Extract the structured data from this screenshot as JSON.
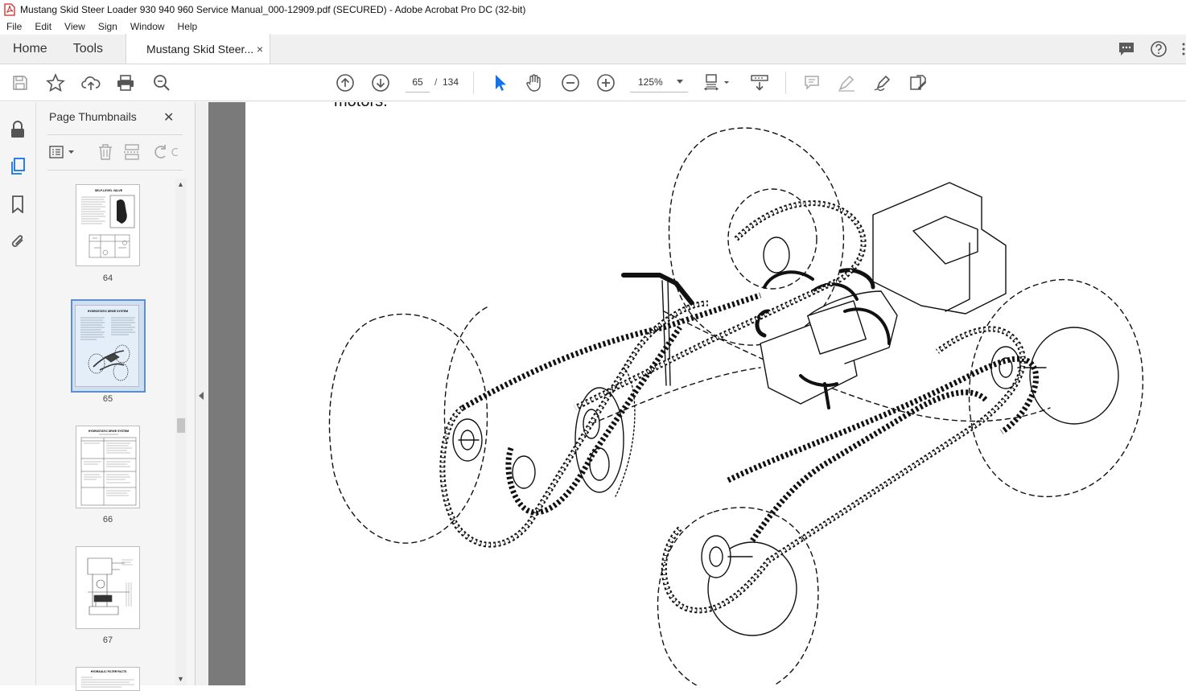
{
  "window": {
    "title": "Mustang Skid Steer Loader 930 940 960 Service Manual_000-12909.pdf (SECURED) - Adobe Acrobat Pro DC (32-bit)"
  },
  "menu": [
    "File",
    "Edit",
    "View",
    "Sign",
    "Window",
    "Help"
  ],
  "tabs": {
    "home": "Home",
    "tools": "Tools",
    "document": "Mustang Skid Steer...",
    "close": "×"
  },
  "toolbar": {
    "page_current": "65",
    "page_separator": "/",
    "page_total": "134",
    "zoom": "125%"
  },
  "thumbnail_panel": {
    "title": "Page Thumbnails",
    "close": "✕",
    "pages": [
      {
        "label": "64",
        "heading": "SELF-LEVEL VALVE"
      },
      {
        "label": "65",
        "heading": "HYDROSTATIC DRIVE SYSTEM",
        "selected": true
      },
      {
        "label": "66",
        "heading": "HYDROSTATIC DRIVE SYSTEM"
      },
      {
        "label": "67",
        "heading": ""
      },
      {
        "label": "",
        "heading": "HYDRAULIC FILTER FACTS"
      }
    ]
  },
  "document": {
    "top_text": "motors.",
    "figure": "skid-steer chain drive assembly illustration"
  },
  "colors": {
    "accent_blue": "#1473e6",
    "selected_thumb": "#5b8fcf",
    "doc_background": "#7a7a7a"
  }
}
